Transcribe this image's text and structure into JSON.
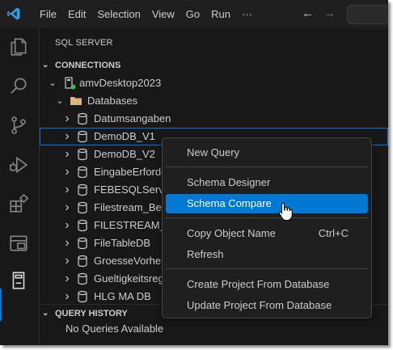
{
  "menubar": {
    "items": [
      "File",
      "Edit",
      "Selection",
      "View",
      "Go",
      "Run",
      "···"
    ]
  },
  "sidebar": {
    "title": "SQL SERVER",
    "connections_header": "CONNECTIONS",
    "server": "amvDesktop2023",
    "databases_folder": "Databases",
    "databases": [
      "Datumsangaben",
      "DemoDB_V1",
      "DemoDB_V2",
      "EingabeErforde",
      "FEBESQLServer",
      "Filestream_Beis",
      "FILESTREAM_D",
      "FileTableDB",
      "GroesseVorher",
      "Gueltigkeitsreg",
      "HLG MA DB"
    ],
    "selected_database": "DemoDB_V1",
    "query_history_header": "QUERY HISTORY",
    "query_history_empty": "No Queries Available"
  },
  "context_menu": {
    "groups": [
      [
        {
          "label": "New Query",
          "shortcut": ""
        }
      ],
      [
        {
          "label": "Schema Designer",
          "shortcut": ""
        },
        {
          "label": "Schema Compare",
          "shortcut": ""
        }
      ],
      [
        {
          "label": "Copy Object Name",
          "shortcut": "Ctrl+C"
        },
        {
          "label": "Refresh",
          "shortcut": ""
        }
      ],
      [
        {
          "label": "Create Project From Database",
          "shortcut": ""
        },
        {
          "label": "Update Project From Database",
          "shortcut": ""
        }
      ]
    ],
    "highlighted": "Schema Compare"
  },
  "colors": {
    "accent": "#0078d4",
    "background": "#181818",
    "menu_background": "#1f1f1f",
    "text": "#cccccc",
    "connected_dot": "#3fb950",
    "folder": "#dcb67a"
  },
  "icons": {
    "activity_bar": [
      "explorer-icon",
      "search-icon",
      "source-control-icon",
      "run-debug-icon",
      "extensions-icon",
      "remote-explorer-icon",
      "sql-server-icon"
    ],
    "tree": [
      "server-icon",
      "folder-icon",
      "database-icon"
    ]
  }
}
